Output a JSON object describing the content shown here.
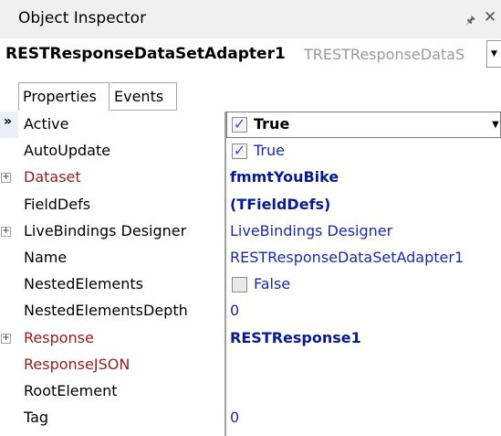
{
  "titlebar": {
    "title": "Object Inspector",
    "pin_icon": "pin-icon",
    "close_icon": "close-icon"
  },
  "object_selector": {
    "name": "RESTResponseDataSetAdapter1",
    "type": "TRESTResponseDataS"
  },
  "tabs": [
    {
      "label": "Properties",
      "selected": true
    },
    {
      "label": "Events",
      "selected": false
    }
  ],
  "properties": [
    {
      "name": "Active",
      "value": "True",
      "checkbox": true,
      "checked": true,
      "expandable": false,
      "reference": false,
      "active": true
    },
    {
      "name": "AutoUpdate",
      "value": "True",
      "checkbox": true,
      "checked": true,
      "expandable": false,
      "reference": false
    },
    {
      "name": "Dataset",
      "value": "fmmtYouBike",
      "checkbox": false,
      "expandable": true,
      "reference": true,
      "bold": true
    },
    {
      "name": "FieldDefs",
      "value": "(TFieldDefs)",
      "checkbox": false,
      "expandable": false,
      "reference": false,
      "bold": true
    },
    {
      "name": "LiveBindings Designer",
      "value": "LiveBindings Designer",
      "checkbox": false,
      "expandable": true,
      "reference": false
    },
    {
      "name": "Name",
      "value": "RESTResponseDataSetAdapter1",
      "checkbox": false,
      "expandable": false,
      "reference": false
    },
    {
      "name": "NestedElements",
      "value": "False",
      "checkbox": true,
      "checked": false,
      "expandable": false,
      "reference": false
    },
    {
      "name": "NestedElementsDepth",
      "value": "0",
      "checkbox": false,
      "expandable": false,
      "reference": false
    },
    {
      "name": "Response",
      "value": "RESTResponse1",
      "checkbox": false,
      "expandable": true,
      "reference": true,
      "bold": true
    },
    {
      "name": "ResponseJSON",
      "value": "",
      "checkbox": false,
      "expandable": false,
      "reference": true
    },
    {
      "name": "RootElement",
      "value": "",
      "checkbox": false,
      "expandable": false,
      "reference": false
    },
    {
      "name": "Tag",
      "value": "0",
      "checkbox": false,
      "expandable": false,
      "reference": false
    }
  ],
  "colors": {
    "value_text": "#1a2aa8",
    "reference_name": "#9b1b1b",
    "checkbox_tick": "#3355cc"
  }
}
